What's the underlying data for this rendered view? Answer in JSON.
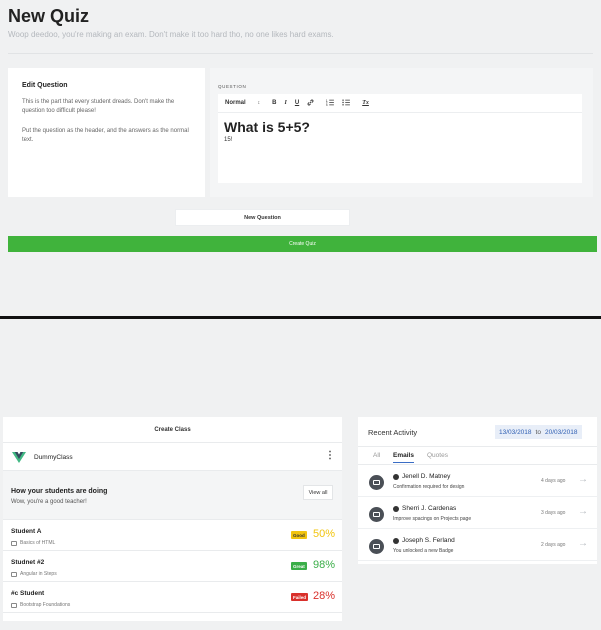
{
  "quiz": {
    "title": "New Quiz",
    "subtitle": "Woop deedoo, you're making an exam. Don't make it too hard tho, no one likes hard exams.",
    "edit_title": "Edit Question",
    "edit_p1": "This is the part that every student dreads. Don't make the question too difficult please!",
    "edit_p2": "Put the question as the header, and the answers as the normal text.",
    "question_label": "QUESTION",
    "toolbar": {
      "format": "Normal",
      "format_arrow": "↕",
      "bold": "B",
      "italic": "I",
      "underline": "U",
      "link": "🔗",
      "ordered_list": "☰",
      "bullet_list": "☰",
      "clear": "Tx"
    },
    "question_heading": "What is 5+5?",
    "question_text": "15!",
    "new_question_label": "New Question",
    "create_quiz_label": "Create Quiz"
  },
  "classes": {
    "create_class_label": "Create Class",
    "class_name": "DummyClass",
    "kebab": "⋮",
    "how_title": "How your students are doing",
    "how_sub": "Wow, you're a good teacher!",
    "view_all_label": "View all",
    "students": [
      {
        "name": "Student A",
        "course": "Basics of HTML",
        "badge": "Good",
        "percent": "50%",
        "color": "#f1c40f",
        "badge_text": "#333"
      },
      {
        "name": "Studnet #2",
        "course": "Angular in Steps",
        "badge": "Great",
        "percent": "98%",
        "color": "#3aae48",
        "badge_text": "#fff"
      },
      {
        "name": "#c Student",
        "course": "Bootstrap Foundations",
        "badge": "Failed",
        "percent": "28%",
        "color": "#d9302b",
        "badge_text": "#fff"
      }
    ]
  },
  "activity": {
    "title": "Recent Activity",
    "date_from": "13/03/2018",
    "date_to_word": "to",
    "date_to": "20/03/2018",
    "tabs": [
      "All",
      "Emails",
      "Quotes"
    ],
    "active_tab": "Emails",
    "items": [
      {
        "name": "Jenell D. Matney",
        "message": "Confirmation required for design",
        "time": "4 days ago"
      },
      {
        "name": "Sherri J. Cardenas",
        "message": "Improve spacings on Projects page",
        "time": "3 days ago"
      },
      {
        "name": "Joseph S. Ferland",
        "message": "You unlocked a new Badge",
        "time": "2 days ago"
      }
    ],
    "arrow": "→"
  },
  "colors": {
    "create_quiz_green": "#40b33c",
    "date_blue": "#2f5fb3",
    "vue_green": "#41b883",
    "vue_dark": "#35495e"
  }
}
